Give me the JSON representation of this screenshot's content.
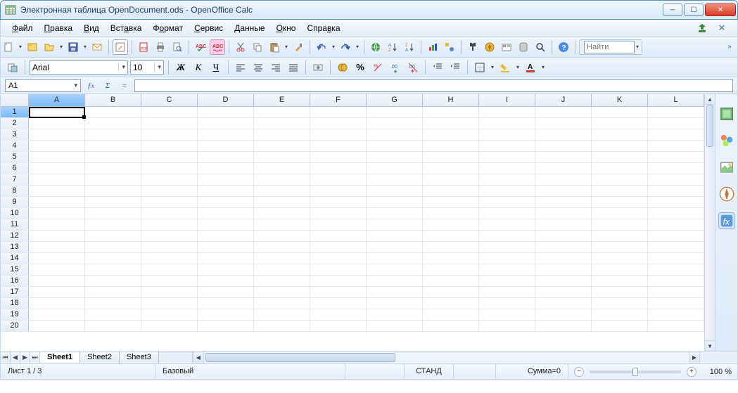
{
  "window": {
    "title": "Электронная таблица OpenDocument.ods - OpenOffice Calc"
  },
  "menu": {
    "items": [
      {
        "label": "Файл",
        "u": 0
      },
      {
        "label": "Правка",
        "u": 0
      },
      {
        "label": "Вид",
        "u": 0
      },
      {
        "label": "Вставка",
        "u": 3
      },
      {
        "label": "Формат",
        "u": 1
      },
      {
        "label": "Сервис",
        "u": 0
      },
      {
        "label": "Данные",
        "u": 0
      },
      {
        "label": "Окно",
        "u": 0
      },
      {
        "label": "Справка",
        "u": 4
      }
    ]
  },
  "find": {
    "placeholder": "Найти"
  },
  "format": {
    "font": "Arial",
    "size": "10"
  },
  "formula": {
    "cellref": "A1",
    "value": ""
  },
  "columns": [
    "A",
    "B",
    "C",
    "D",
    "E",
    "F",
    "G",
    "H",
    "I",
    "J",
    "K",
    "L"
  ],
  "rows": 20,
  "active": {
    "col": 0,
    "row": 0
  },
  "sheets": {
    "tabs": [
      "Sheet1",
      "Sheet2",
      "Sheet3"
    ],
    "active": 0
  },
  "status": {
    "sheet": "Лист 1 / 3",
    "style": "Базовый",
    "mode": "СТАНД",
    "sum": "Сумма=0",
    "zoom": "100 %"
  }
}
